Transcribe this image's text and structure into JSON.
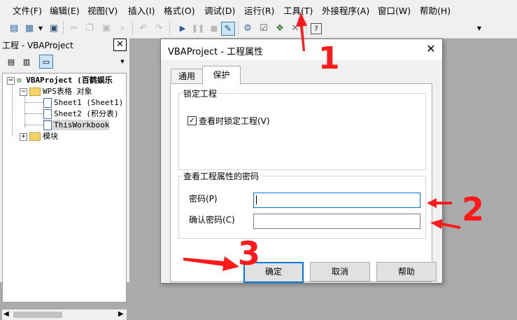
{
  "menu": [
    "文件(F)",
    "编辑(E)",
    "视图(V)",
    "插入(I)",
    "格式(O)",
    "调试(D)",
    "运行(R)",
    "工具(T)",
    "外接程序(A)",
    "窗口(W)",
    "帮助(H)"
  ],
  "toolbar": {
    "icons": [
      "vba-doc-icon",
      "insert-module-icon",
      "dropdown-arrow-icon",
      "save-icon",
      "cut-icon",
      "copy-icon",
      "paste-icon",
      "find-icon",
      "undo-icon",
      "redo-icon",
      "run-icon",
      "pause-icon",
      "stop-icon",
      "design-mode-icon",
      "project-explorer-icon",
      "properties-icon",
      "object-browser-icon",
      "toolbox-icon",
      "help-icon",
      "overflow-arrow-icon"
    ]
  },
  "project_panel": {
    "title": "工程 - VBAProject",
    "close_glyph": "✕",
    "tree": {
      "root": "VBAProject (百鹤娱乐",
      "folder1": "WPS表格 对象",
      "items": [
        "Sheet1 (Sheet1)",
        "Sheet2 (积分表)",
        "ThisWorkbook"
      ],
      "folder2": "模块"
    }
  },
  "dialog": {
    "title": "VBAProject - 工程属性",
    "close_glyph": "✕",
    "tabs": [
      "通用",
      "保护"
    ],
    "lock_group": {
      "label": "锁定工程",
      "checkbox_label": "查看时锁定工程(V)",
      "checked": true
    },
    "password_group": {
      "label": "查看工程属性的密码",
      "password_label": "密码(P)",
      "confirm_label": "确认密码(C)",
      "password_value": "",
      "confirm_value": ""
    },
    "buttons": {
      "ok": "确定",
      "cancel": "取消",
      "help": "帮助"
    }
  },
  "annotations": {
    "color": "#ff1a1a",
    "labels": [
      "1",
      "2",
      "3"
    ]
  }
}
